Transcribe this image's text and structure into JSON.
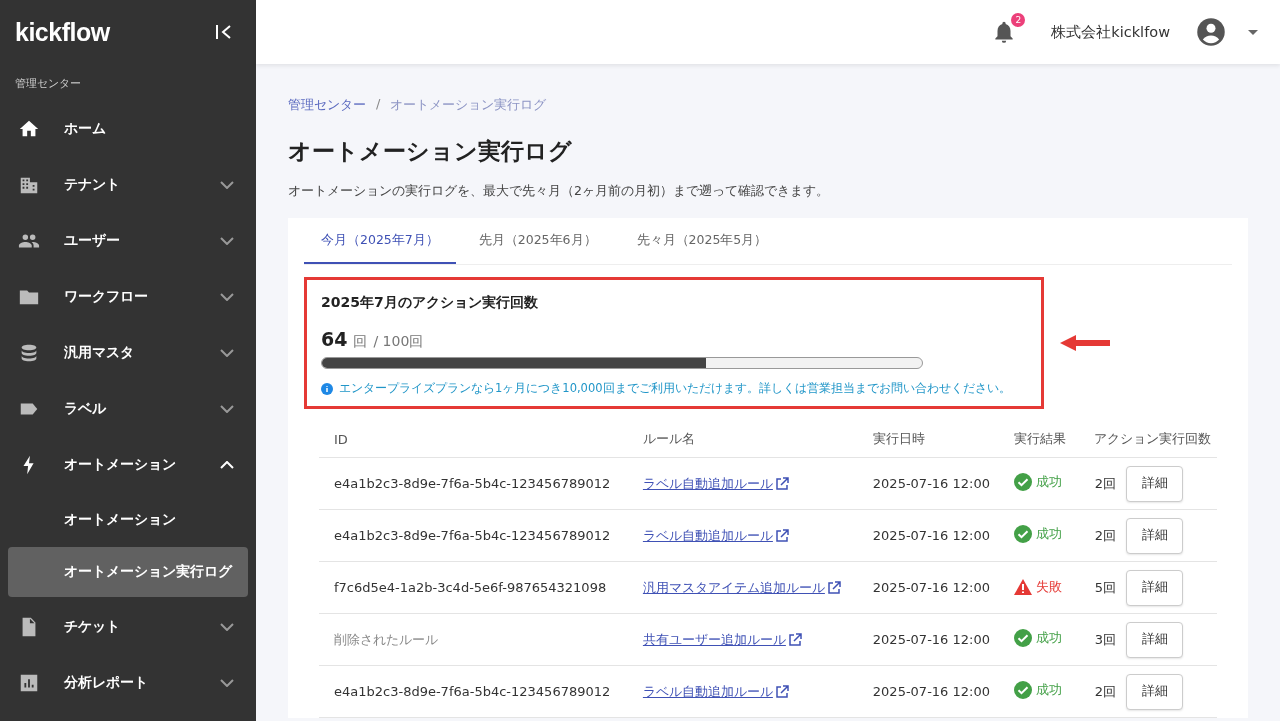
{
  "sidebar": {
    "logo": "kickflow",
    "section_label": "管理センター",
    "items": [
      {
        "label": "ホーム",
        "kind": "home"
      },
      {
        "label": "テナント",
        "kind": "building",
        "expanded": false
      },
      {
        "label": "ユーザー",
        "kind": "people",
        "expanded": false
      },
      {
        "label": "ワークフロー",
        "kind": "folder",
        "expanded": false
      },
      {
        "label": "汎用マスタ",
        "kind": "database",
        "expanded": false
      },
      {
        "label": "ラベル",
        "kind": "label",
        "expanded": false
      },
      {
        "label": "オートメーション",
        "kind": "bolt",
        "expanded": true,
        "children": [
          {
            "label": "オートメーション",
            "selected": false
          },
          {
            "label": "オートメーション実行ログ",
            "selected": true
          }
        ]
      },
      {
        "label": "チケット",
        "kind": "file",
        "expanded": false
      },
      {
        "label": "分析レポート",
        "kind": "chart",
        "expanded": false
      }
    ]
  },
  "header": {
    "notification_count": "2",
    "company": "株式会社kicklfow"
  },
  "breadcrumb": [
    "管理センター",
    "オートメーション実行ログ"
  ],
  "breadcrumb_separator": "/",
  "title": "オートメーション実行ログ",
  "description": "オートメーションの実行ログを、最大で先々月（2ヶ月前の月初）まで遡って確認できます。",
  "tabs": [
    {
      "label": "今月（2025年7月）",
      "selected": true
    },
    {
      "label": "先月（2025年6月）",
      "selected": false
    },
    {
      "label": "先々月（2025年5月）",
      "selected": false
    }
  ],
  "usage": {
    "title": "2025年7月のアクション実行回数",
    "count": "64",
    "unit": "回",
    "limit": "/ 100回",
    "level": 0.64,
    "note": "エンタープライズプランなら1ヶ月につき10,000回までご利用いただけます。詳しくは営業担当までお問い合わせください。",
    "highlighted": true,
    "arrow": true
  },
  "table": {
    "columns": [
      "ID",
      "ルール名",
      "実行日時",
      "実行結果",
      "アクション実行回数"
    ],
    "rows": [
      {
        "id": {
          "text": "e4a1b2c3-8d9e-7f6a-5b4c-123456789012",
          "kind": "id"
        },
        "rule": "ラベル自動追加ルール",
        "datetime": "2025-07-16 12:00",
        "result": {
          "text": "成功",
          "kind": "success"
        },
        "count": "2回",
        "action": "詳細"
      },
      {
        "id": {
          "text": "e4a1b2c3-8d9e-7f6a-5b4c-123456789012",
          "kind": "id"
        },
        "rule": "ラベル自動追加ルール",
        "datetime": "2025-07-16 12:00",
        "result": {
          "text": "成功",
          "kind": "success"
        },
        "count": "2回",
        "action": "詳細"
      },
      {
        "id": {
          "text": "f7c6d5e4-1a2b-3c4d-5e6f-987654321098",
          "kind": "id"
        },
        "rule": "汎用マスタアイテム追加ルール",
        "datetime": "2025-07-16 12:00",
        "result": {
          "text": "失敗",
          "kind": "failure"
        },
        "count": "5回",
        "action": "詳細"
      },
      {
        "id": {
          "text": "削除されたルール",
          "kind": "deleted"
        },
        "rule": "共有ユーザー追加ルール",
        "datetime": "2025-07-16 12:00",
        "result": {
          "text": "成功",
          "kind": "success"
        },
        "count": "3回",
        "action": "詳細"
      },
      {
        "id": {
          "text": "e4a1b2c3-8d9e-7f6a-5b4c-123456789012",
          "kind": "id"
        },
        "rule": "ラベル自動追加ルール",
        "datetime": "2025-07-16 12:00",
        "result": {
          "text": "成功",
          "kind": "success"
        },
        "count": "2回",
        "action": "詳細"
      }
    ]
  }
}
